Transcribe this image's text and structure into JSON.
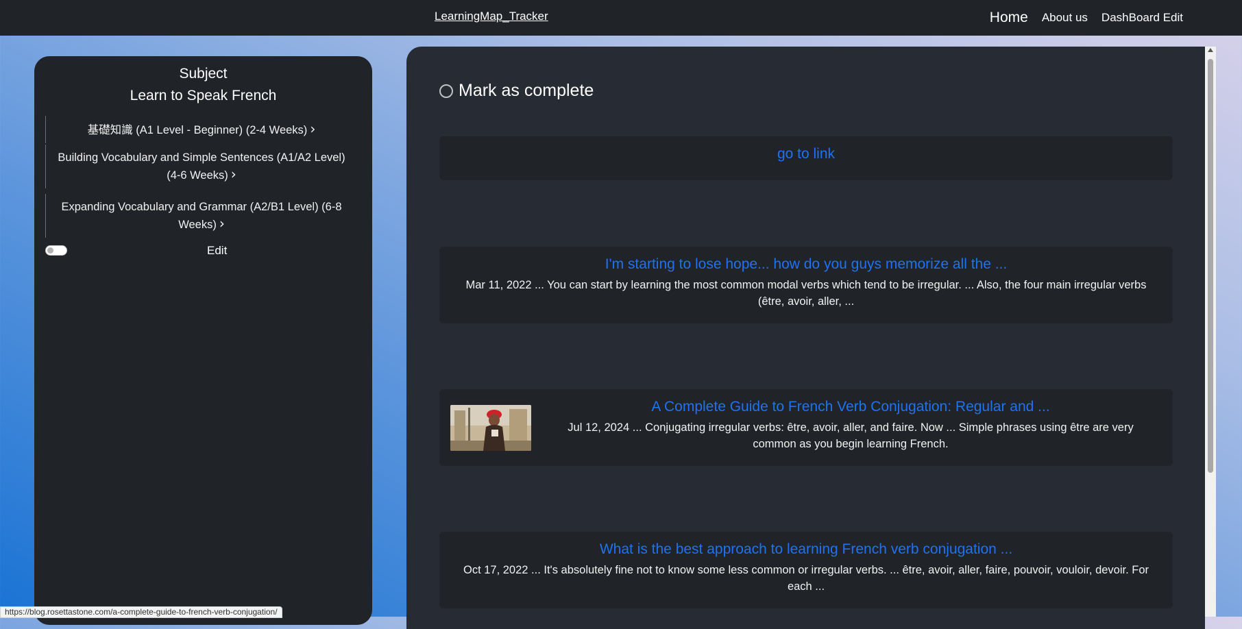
{
  "header": {
    "brand": "LearningMap_Tracker",
    "nav": [
      {
        "label": "Home"
      },
      {
        "label": "About us"
      },
      {
        "label": "DashBoard Edit"
      }
    ]
  },
  "sidebar": {
    "subject_label": "Subject",
    "subject_title": "Learn to Speak French",
    "items": [
      {
        "label": "基礎知識 (A1 Level - Beginner) (2-4 Weeks)"
      },
      {
        "label": "Building Vocabulary and Simple Sentences (A1/A2 Level) (4-6 Weeks)"
      },
      {
        "label": "Expanding Vocabulary and Grammar (A2/B1 Level) (6-8 Weeks)"
      }
    ],
    "edit_label": "Edit",
    "edit_enabled": false
  },
  "main": {
    "complete_label": "Mark as complete",
    "go_link_label": "go to link",
    "results": [
      {
        "title": "I'm starting to lose hope... how do you guys memorize all the ...",
        "snippet": "Mar 11, 2022 ... You can start by learning the most common modal verbs which tend to be irregular. ... Also, the four main irregular verbs (être, avoir, aller, ..."
      },
      {
        "title": "A Complete Guide to French Verb Conjugation: Regular and ...",
        "snippet": "Jul 12, 2024 ... Conjugating irregular verbs: être, avoir, aller, and faire. Now ... Simple phrases using être are very common as you begin learning French.",
        "has_thumbnail": true
      },
      {
        "title": "What is the best approach to learning French verb conjugation ...",
        "snippet": "Oct 17, 2022 ... It's absolutely fine not to know some less common or irregular verbs. ... être, avoir, aller, faire, pouvoir, vouloir, devoir. For each ..."
      }
    ]
  },
  "status_bar": {
    "hover_url": "https://blog.rosettastone.com/a-complete-guide-to-french-verb-conjugation/"
  },
  "colors": {
    "link": "#1e73f5",
    "panel": "#202328",
    "main_panel": "#272b33"
  }
}
